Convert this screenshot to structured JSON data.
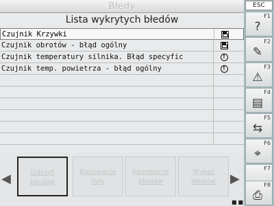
{
  "window": {
    "title": "Błędy"
  },
  "panel": {
    "title": "Lista wykrytych błedów"
  },
  "errors": [
    {
      "name": "Czujnik Krzywki",
      "status_icon": "disk-icon"
    },
    {
      "name": "Czujnik obrotów - błąd ogólny",
      "status_icon": "disk-icon"
    },
    {
      "name": "Czujnik temperatury silnika. Błąd specyfic",
      "status_icon": "exclamation-icon"
    },
    {
      "name": "Czujnik temp. powietrza - błąd ogólny",
      "status_icon": "exclamation-icon"
    }
  ],
  "nav": {
    "buttons": [
      {
        "label_line1": "Odczyt",
        "label_line2": "błedów"
      },
      {
        "label_line1": "Kasowanie",
        "label_line2": "listy"
      },
      {
        "label_line1": "Kasowanie",
        "label_line2": "błedów"
      },
      {
        "label_line1": "Wykaz",
        "label_line2": "błedów"
      }
    ]
  },
  "fkeys": {
    "esc": "ESC",
    "labels": [
      "F1",
      "F2",
      "F3",
      "F4",
      "F5",
      "F6",
      "F7",
      "F8"
    ],
    "icons": [
      "help-icon",
      "wrench-icon",
      "warning-icon",
      "print-icon",
      "link-icon",
      "mouse-icon",
      "blank",
      "printer-icon"
    ]
  }
}
